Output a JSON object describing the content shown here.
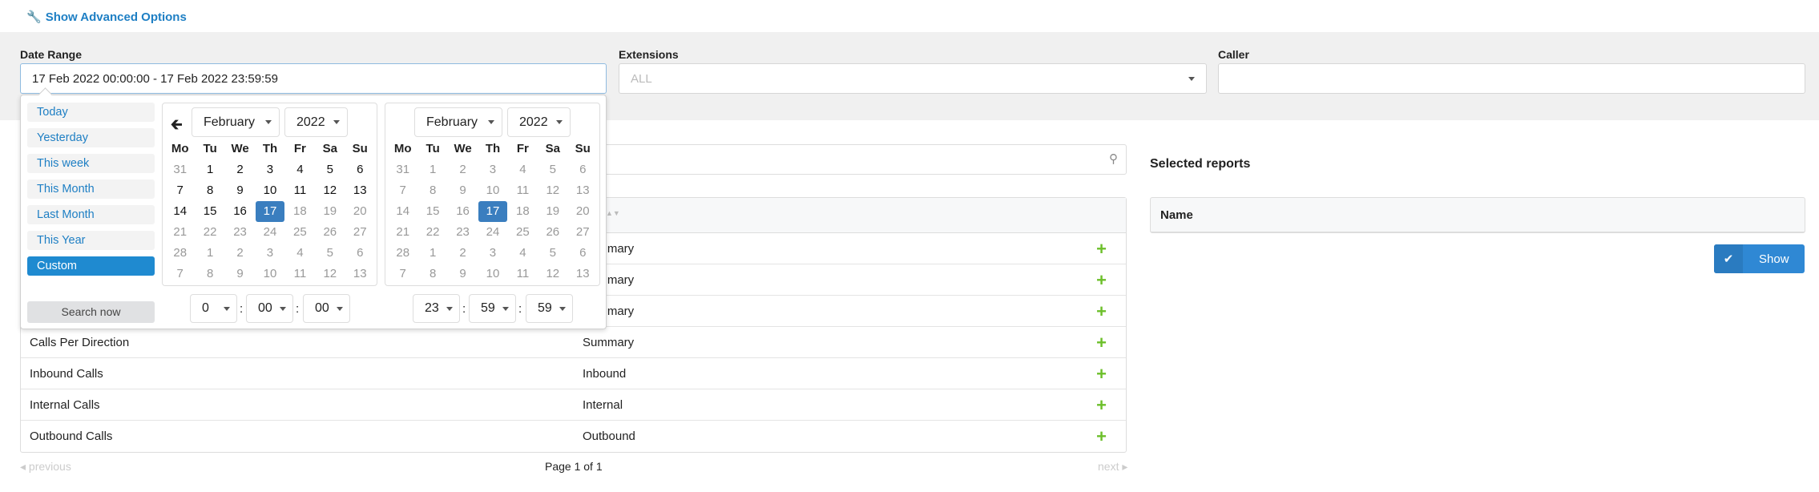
{
  "advanced_link": "Show Advanced Options",
  "filters": {
    "date_range_label": "Date Range",
    "date_range_value": "17 Feb 2022 00:00:00 - 17 Feb 2022 23:59:59",
    "extensions_label": "Extensions",
    "extensions_placeholder": "ALL",
    "caller_label": "Caller",
    "caller_value": ""
  },
  "datepicker": {
    "ranges": [
      "Today",
      "Yesterday",
      "This week",
      "This Month",
      "Last Month",
      "This Year",
      "Custom"
    ],
    "active_range": "Custom",
    "search_now": "Search now",
    "weekdays": [
      "Mo",
      "Tu",
      "We",
      "Th",
      "Fr",
      "Sa",
      "Su"
    ],
    "calendars": [
      {
        "month": "February",
        "year": "2022",
        "active_days": [
          1,
          2,
          3,
          4,
          5,
          6,
          7,
          8,
          9,
          10,
          11,
          12,
          13,
          14,
          15,
          16
        ],
        "selected": 17,
        "weeks": [
          [
            31,
            1,
            2,
            3,
            4,
            5,
            6
          ],
          [
            7,
            8,
            9,
            10,
            11,
            12,
            13
          ],
          [
            14,
            15,
            16,
            17,
            18,
            19,
            20
          ],
          [
            21,
            22,
            23,
            24,
            25,
            26,
            27
          ],
          [
            28,
            1,
            2,
            3,
            4,
            5,
            6
          ],
          [
            7,
            8,
            9,
            10,
            11,
            12,
            13
          ]
        ],
        "time": {
          "hour": "0",
          "minute": "00",
          "second": "00"
        }
      },
      {
        "month": "February",
        "year": "2022",
        "active_days": [],
        "selected": 17,
        "weeks": [
          [
            31,
            1,
            2,
            3,
            4,
            5,
            6
          ],
          [
            7,
            8,
            9,
            10,
            11,
            12,
            13
          ],
          [
            14,
            15,
            16,
            17,
            18,
            19,
            20
          ],
          [
            21,
            22,
            23,
            24,
            25,
            26,
            27
          ],
          [
            28,
            1,
            2,
            3,
            4,
            5,
            6
          ],
          [
            7,
            8,
            9,
            10,
            11,
            12,
            13
          ]
        ],
        "time": {
          "hour": "23",
          "minute": "59",
          "second": "59"
        }
      }
    ]
  },
  "reports": {
    "rows": [
      {
        "name": "",
        "type": "Summary"
      },
      {
        "name": "",
        "type": "Summary"
      },
      {
        "name": "",
        "type": "Summary"
      },
      {
        "name": "Calls Per Direction",
        "type": "Summary"
      },
      {
        "name": "Inbound Calls",
        "type": "Inbound"
      },
      {
        "name": "Internal Calls",
        "type": "Internal"
      },
      {
        "name": "Outbound Calls",
        "type": "Outbound"
      }
    ],
    "pagination": {
      "previous": "previous",
      "page": "Page 1 of 1",
      "next": "next"
    }
  },
  "selected": {
    "title": "Selected reports",
    "name_header": "Name",
    "show_button": "Show"
  },
  "colors": {
    "accent": "#1e7fc4",
    "selected_day": "#3a7ebf",
    "add_icon": "#6cbf2a",
    "show_button": "#2f88d4"
  }
}
